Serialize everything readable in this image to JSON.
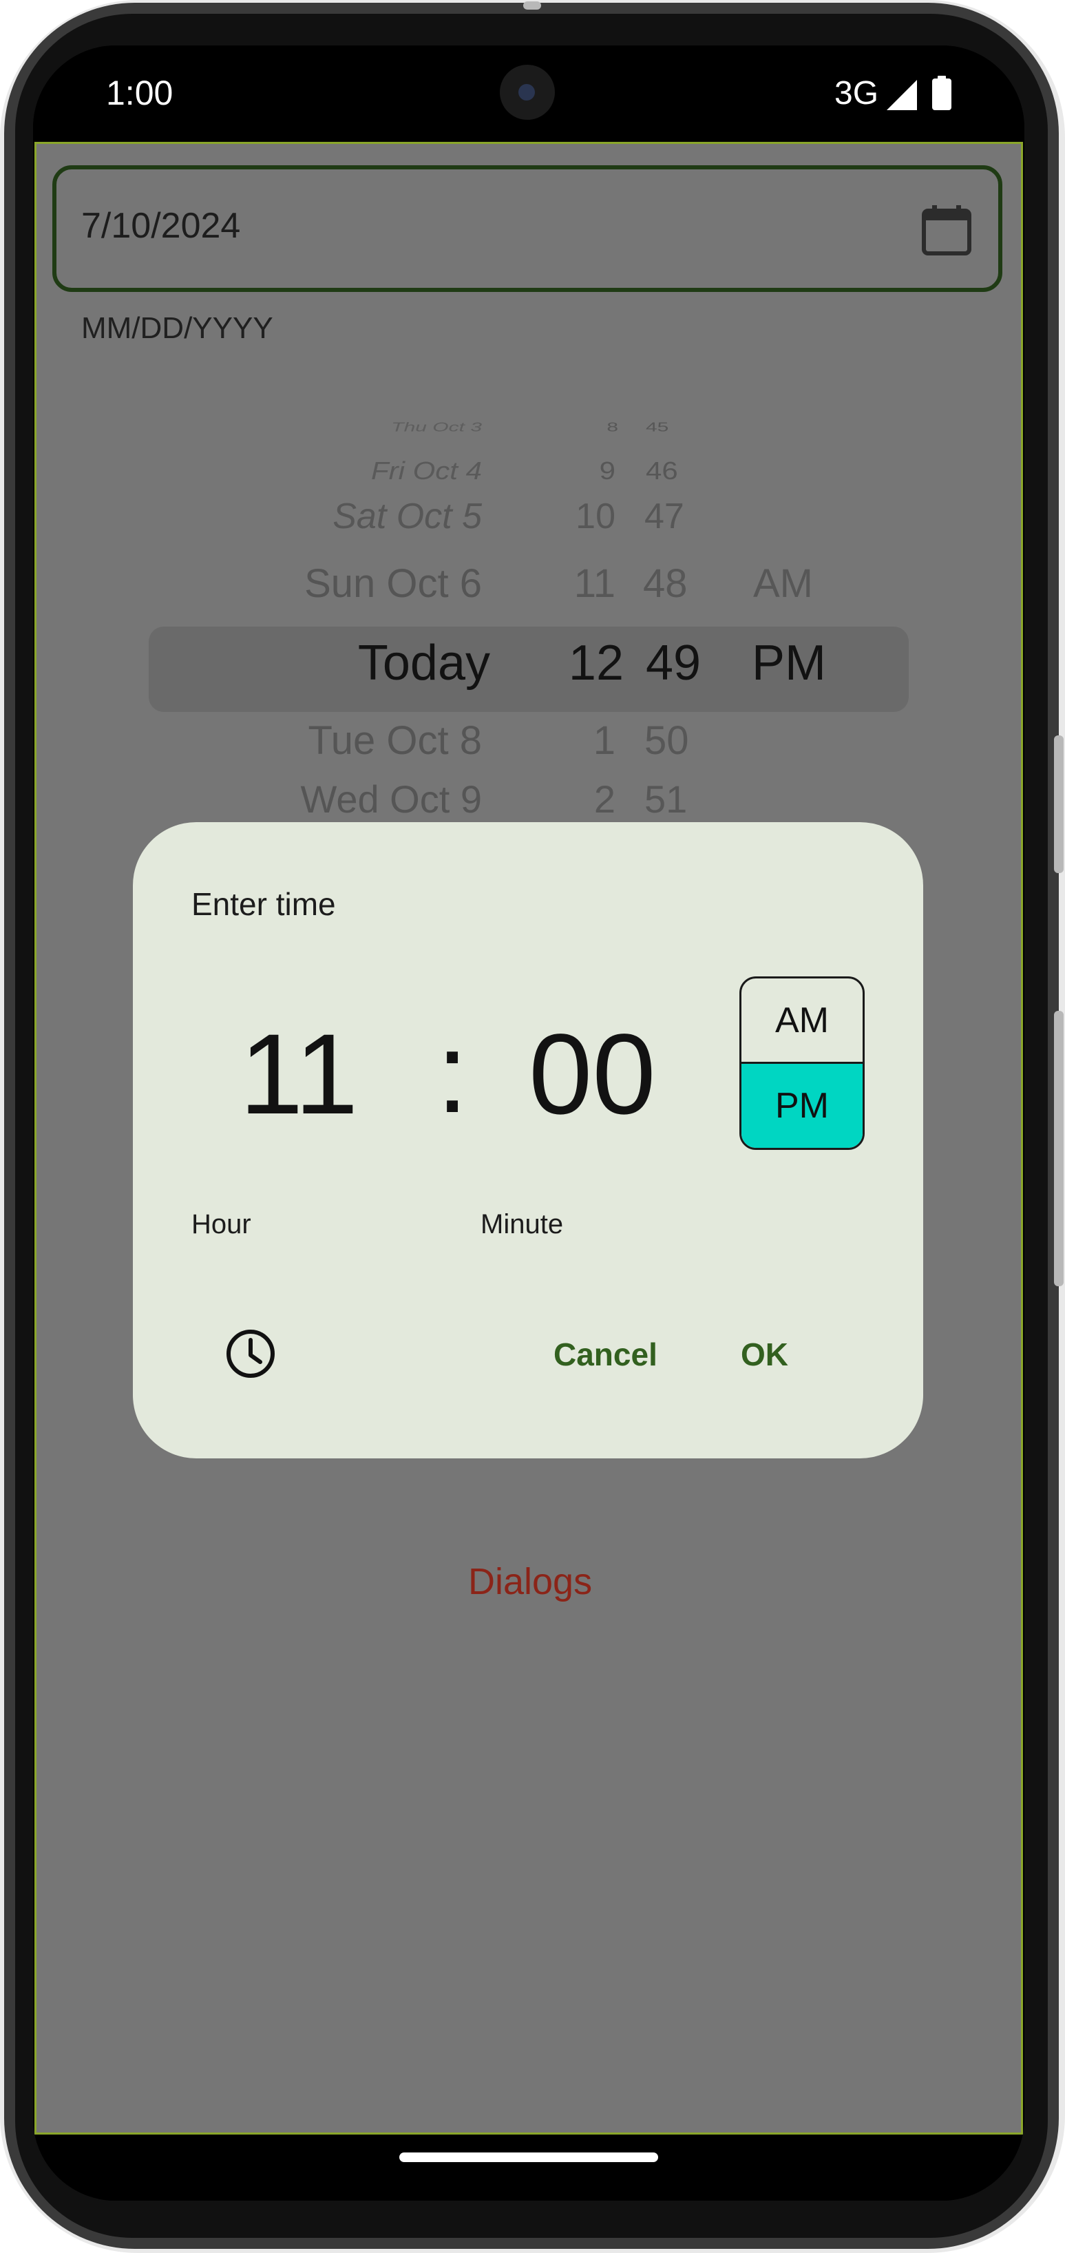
{
  "status_bar": {
    "time": "1:00",
    "network": "3G"
  },
  "date_field": {
    "value": "7/10/2024",
    "hint": "MM/DD/YYYY"
  },
  "wheel_picker": {
    "days": [
      "Thu Oct 3",
      "Fri Oct 4",
      "Sat Oct 5",
      "Sun Oct 6",
      "Today",
      "Tue Oct 8",
      "Wed Oct 9"
    ],
    "hours": [
      "8",
      "9",
      "10",
      "11",
      "12",
      "1",
      "2"
    ],
    "minutes": [
      "45",
      "46",
      "47",
      "48",
      "49",
      "50",
      "51"
    ],
    "periods": [
      "AM",
      "PM"
    ],
    "selected": {
      "day": "Today",
      "hour": "12",
      "minute": "49",
      "period": "PM"
    }
  },
  "time_dialog": {
    "title": "Enter time",
    "hour": "11",
    "separator": ":",
    "minute": "00",
    "am_label": "AM",
    "pm_label": "PM",
    "selected_period": "PM",
    "hour_label": "Hour",
    "minute_label": "Minute",
    "cancel_label": "Cancel",
    "ok_label": "OK"
  },
  "page_label": "Dialogs",
  "colors": {
    "accent_text": "#32601f",
    "selected_period_bg": "#00d6c2",
    "dialog_bg": "#e3e9dc",
    "scrim": "#767676",
    "dialogs_label": "#8b2418"
  },
  "icons": [
    "calendar-icon",
    "clock-icon",
    "signal-icon",
    "battery-icon"
  ]
}
